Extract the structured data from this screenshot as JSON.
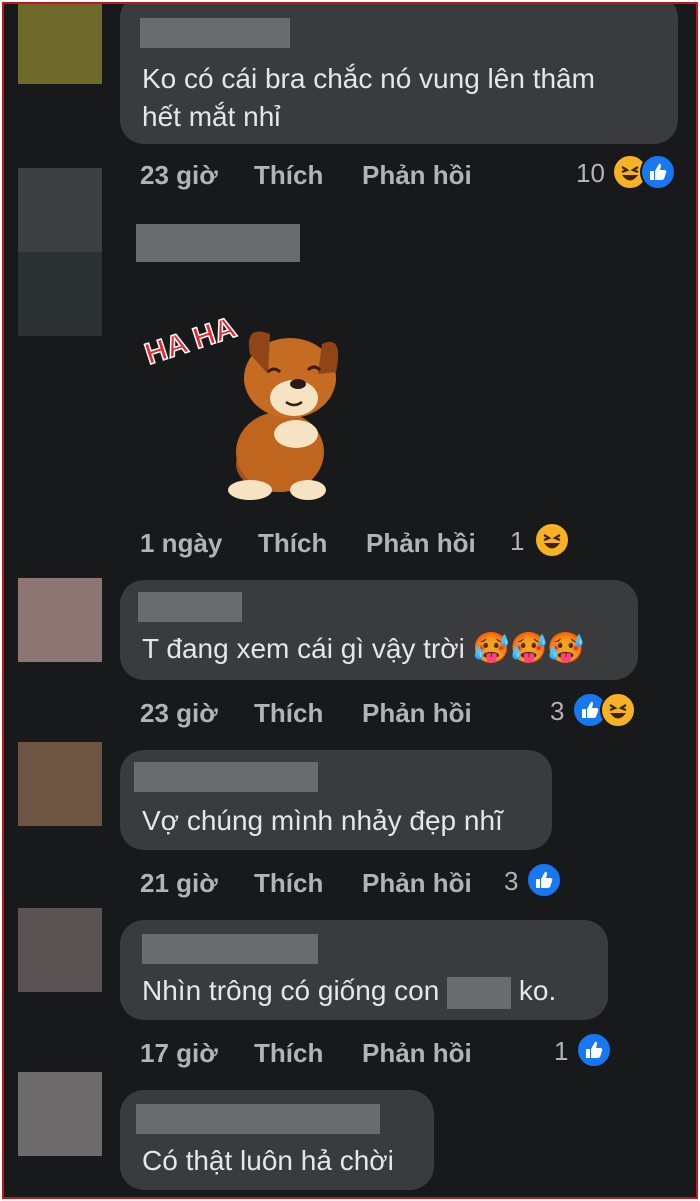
{
  "comments": [
    {
      "text1": "Ko có cái bra chắc nó vung lên thâm",
      "text2": "hết mắt nhỉ",
      "time": "23 giờ",
      "like": "Thích",
      "reply": "Phản hồi",
      "count": "10",
      "reactions": [
        "haha-icon",
        "like-icon"
      ]
    },
    {
      "time": "1 ngày",
      "like": "Thích",
      "reply": "Phản hồi",
      "count": "1",
      "reactions": [
        "haha-icon"
      ],
      "sticker_text": "HA HA"
    },
    {
      "text1": "T đang xem cái gì vậy trời",
      "time": "23 giờ",
      "like": "Thích",
      "reply": "Phản hồi",
      "count": "3",
      "reactions": [
        "like-icon",
        "haha-icon"
      ],
      "emojis": "🥵🥵🥵"
    },
    {
      "text1": "Vợ chúng mình nhảy đẹp nhĩ",
      "time": "21 giờ",
      "like": "Thích",
      "reply": "Phản hồi",
      "count": "3",
      "reactions": [
        "like-icon"
      ]
    },
    {
      "text1a": "Nhìn trông có giống con",
      "text1b": "ko.",
      "time": "17 giờ",
      "like": "Thích",
      "reply": "Phản hồi",
      "count": "1",
      "reactions": [
        "like-icon"
      ]
    },
    {
      "text1": "Có thật luôn hả chời"
    }
  ],
  "colors": {
    "accent_border": "#c4161c",
    "background": "#18191a",
    "bubble": "#3a3b3c",
    "text": "#e4e6eb",
    "meta": "#b0b3b8",
    "like": "#1877f2",
    "haha": "#f7b125"
  }
}
